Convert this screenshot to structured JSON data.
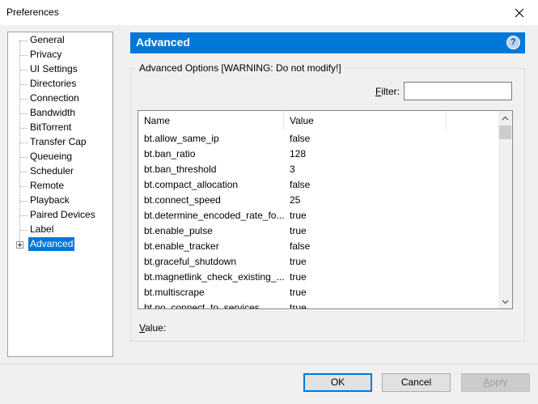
{
  "window": {
    "title": "Preferences"
  },
  "tree": {
    "items": [
      {
        "label": "General"
      },
      {
        "label": "Privacy"
      },
      {
        "label": "UI Settings"
      },
      {
        "label": "Directories"
      },
      {
        "label": "Connection"
      },
      {
        "label": "Bandwidth"
      },
      {
        "label": "BitTorrent"
      },
      {
        "label": "Transfer Cap"
      },
      {
        "label": "Queueing"
      },
      {
        "label": "Scheduler"
      },
      {
        "label": "Remote"
      },
      {
        "label": "Playback"
      },
      {
        "label": "Paired Devices"
      },
      {
        "label": "Label"
      },
      {
        "label": "Advanced",
        "selected": true
      }
    ]
  },
  "panel": {
    "title": "Advanced",
    "help_icon": "?"
  },
  "group": {
    "legend": "Advanced Options [WARNING: Do not modify!]",
    "filter_label_accel": "F",
    "filter_label_rest": "ilter:",
    "filter_value": ""
  },
  "list": {
    "columns": [
      "Name",
      "Value"
    ],
    "rows": [
      {
        "name": "bt.allow_same_ip",
        "value": "false"
      },
      {
        "name": "bt.ban_ratio",
        "value": "128"
      },
      {
        "name": "bt.ban_threshold",
        "value": "3"
      },
      {
        "name": "bt.compact_allocation",
        "value": "false"
      },
      {
        "name": "bt.connect_speed",
        "value": "25"
      },
      {
        "name": "bt.determine_encoded_rate_fo...",
        "value": "true"
      },
      {
        "name": "bt.enable_pulse",
        "value": "true"
      },
      {
        "name": "bt.enable_tracker",
        "value": "false"
      },
      {
        "name": "bt.graceful_shutdown",
        "value": "true"
      },
      {
        "name": "bt.magnetlink_check_existing_...",
        "value": "true"
      },
      {
        "name": "bt.multiscrape",
        "value": "true"
      },
      {
        "name": "bt.no_connect_to_services",
        "value": "true"
      }
    ]
  },
  "value_label_accel": "V",
  "value_label_rest": "alue:",
  "buttons": {
    "ok": "OK",
    "cancel": "Cancel",
    "apply_accel": "A",
    "apply_rest": "pply"
  },
  "colors": {
    "accent": "#0078d7",
    "background": "#f0f0f0"
  },
  "icons": {
    "close": "close-icon",
    "help": "help-icon",
    "expand": "plus-expander-icon",
    "scroll_up": "chevron-up-icon",
    "scroll_down": "chevron-down-icon"
  }
}
